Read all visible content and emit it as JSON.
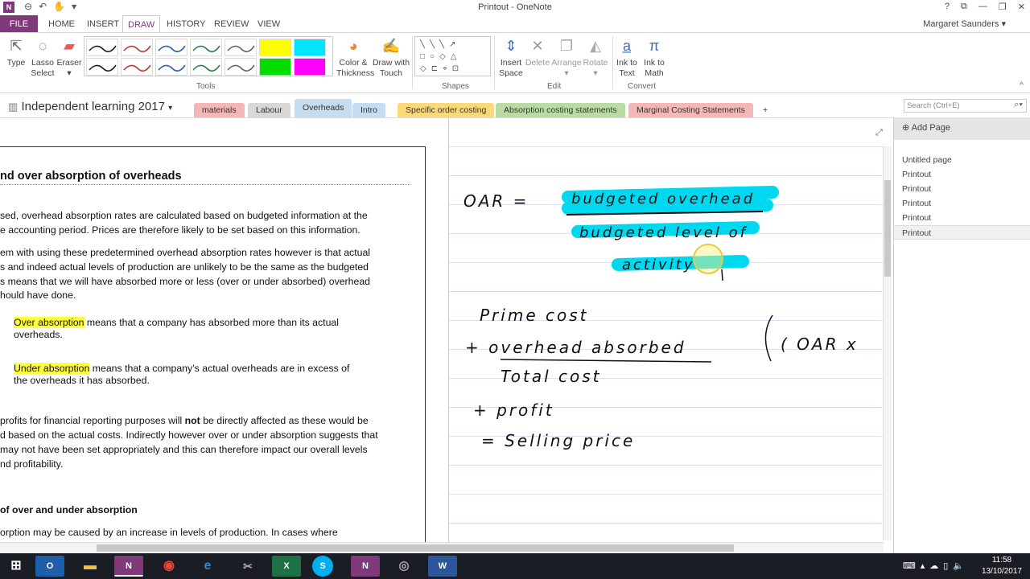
{
  "window": {
    "title": "Printout - OneNote",
    "app_icon": "N",
    "controls": [
      "?",
      "⧉",
      "—",
      "❐",
      "✕"
    ]
  },
  "ribbon_tabs": [
    "FILE",
    "HOME",
    "INSERT",
    "DRAW",
    "HISTORY",
    "REVIEW",
    "VIEW"
  ],
  "active_tab": "DRAW",
  "user": "Margaret Saunders",
  "ribbon": {
    "type": {
      "line1": "Type",
      "line2": ""
    },
    "lasso": {
      "line1": "Lasso",
      "line2": "Select"
    },
    "eraser": {
      "line1": "Eraser",
      "line2": ""
    },
    "color_thickness": {
      "line1": "Color &",
      "line2": "Thickness"
    },
    "draw_touch": {
      "line1": "Draw with",
      "line2": "Touch"
    },
    "insert_space": {
      "line1": "Insert",
      "line2": "Space"
    },
    "delete": {
      "line1": "Delete",
      "line2": ""
    },
    "arrange": {
      "line1": "Arrange",
      "line2": ""
    },
    "rotate": {
      "line1": "Rotate",
      "line2": ""
    },
    "ink_text": {
      "line1": "Ink to",
      "line2": "Text"
    },
    "ink_math": {
      "line1": "Ink to",
      "line2": "Math"
    },
    "groups": {
      "tools": "Tools",
      "shapes": "Shapes",
      "edit": "Edit",
      "convert": "Convert"
    }
  },
  "pen_colors": [
    "#222222",
    "#c0392b",
    "#2e5fa8",
    "#2d7d4e",
    "#666666",
    "#ffff00",
    "#00e5ff",
    "#222222",
    "#c0392b",
    "#2e5fa8",
    "#2d7d4e",
    "#666666",
    "#00dd00",
    "#ff00ff"
  ],
  "notebook": {
    "name": "Independent learning 2017",
    "sections": [
      {
        "label": "materials",
        "color": "#f4b6b6"
      },
      {
        "label": "Labour",
        "color": "#d8d8d8"
      },
      {
        "label": "Overheads",
        "color": "#c6dcf0"
      },
      {
        "label": "Intro",
        "color": "#c6dcf0"
      },
      {
        "label": "Specific order costing",
        "color": "#fbd97a"
      },
      {
        "label": "Absorption costing statements",
        "color": "#b9dca4"
      },
      {
        "label": "Marginal Costing Statements",
        "color": "#f4b6b6"
      },
      {
        "label": "+",
        "color": "#ffffff"
      }
    ],
    "search_placeholder": "Search (Ctrl+E)"
  },
  "printout": {
    "heading": "nd over absorption of overheads",
    "lines": [
      "sed, overhead absorption rates are calculated based on budgeted information at the",
      "e accounting period. Prices are therefore likely to be set based on this information.",
      "em with using these predetermined overhead absorption rates however is that actual",
      "s and indeed actual levels of production are unlikely to be the same as the budgeted",
      "s means that we will have absorbed more or less (over or under absorbed) overhead",
      "hould have done.",
      "means that a company has absorbed more than its actual",
      "overheads.",
      "means that a company’s actual overheads are in excess of",
      "the overheads it has absorbed.",
      "profits for financial reporting purposes will ",
      "not",
      " be directly affected as these would be",
      "d based on the actual costs. Indirectly however over or under absorption suggests that",
      "may not have been set appropriately and this can therefore impact our overall levels",
      "nd profitability.",
      "of over and under absorption",
      "orption may be caused by an increase in levels of production. In cases where"
    ],
    "over_absorption": "Over absorption",
    "under_absorption": "Under absorption"
  },
  "handwriting": {
    "oar": "OAR =",
    "numerator": "budgeted overhead",
    "denominator1": "budgeted level of",
    "denominator2": "activity",
    "prime_cost": "Prime cost",
    "plus_overhead": "+ overhead absorbed",
    "bracket": "( OAR x",
    "total_cost": "Total cost",
    "plus_profit": "+ profit",
    "selling_price": "= Selling price"
  },
  "pages": {
    "add_label": "Add Page",
    "items": [
      "Untitled page",
      "Printout",
      "Printout",
      "Printout",
      "Printout",
      "Printout"
    ]
  },
  "taskbar": {
    "time": "11:58",
    "date": "13/10/2017"
  }
}
